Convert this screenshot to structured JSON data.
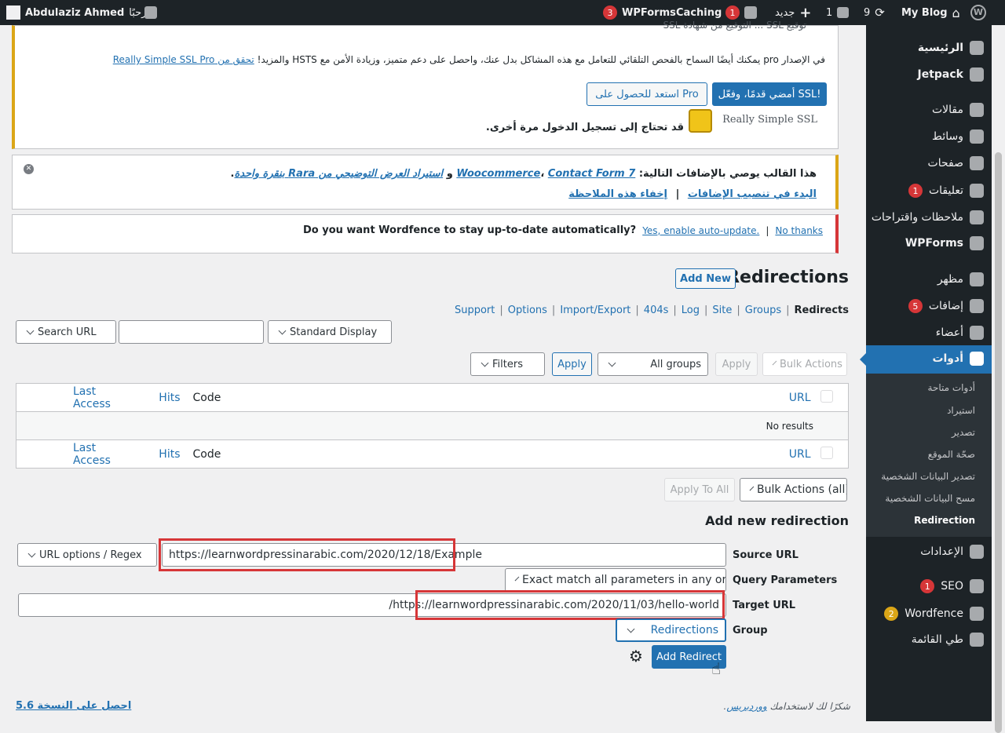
{
  "adminbar": {
    "wp_logo": "wordpress-logo",
    "site_name": "My Blog",
    "updates_count": "9",
    "comments_count": "1",
    "new_label": "جديد",
    "yoast_count": "1",
    "caching_label": "Caching",
    "wpforms_label": "WPForms",
    "wpforms_count": "3",
    "greeting": "مرحبًا،",
    "user_name": "Abdulaziz Ahmed"
  },
  "sidebar": {
    "items": [
      {
        "label": "الرئيسية",
        "icon": "dashboard-icon"
      },
      {
        "label": "Jetpack",
        "icon": "jetpack-icon"
      },
      {
        "label": "مقالات",
        "icon": "pin-icon"
      },
      {
        "label": "وسائط",
        "icon": "media-icon"
      },
      {
        "label": "صفحات",
        "icon": "pages-icon"
      },
      {
        "label": "تعليقات",
        "icon": "comments-icon",
        "badge": "1"
      },
      {
        "label": "ملاحظات واقتراحات",
        "icon": "feedback-icon"
      },
      {
        "label": "WPForms",
        "icon": "wpforms-icon"
      },
      {
        "label": "مظهر",
        "icon": "appearance-icon"
      },
      {
        "label": "إضافات",
        "icon": "plugins-icon",
        "badge": "5"
      },
      {
        "label": "أعضاء",
        "icon": "users-icon"
      },
      {
        "label": "أدوات",
        "icon": "tools-icon"
      },
      {
        "label": "الإعدادات",
        "icon": "settings-icon"
      },
      {
        "label": "SEO",
        "icon": "yoast-icon",
        "badge": "1"
      },
      {
        "label": "Wordfence",
        "icon": "wordfence-icon",
        "badge": "2"
      },
      {
        "label": "طي القائمة",
        "icon": "collapse-icon"
      }
    ],
    "submenu": [
      "أدوات متاحة",
      "استيراد",
      "تصدير",
      "صحّة الموقع",
      "تصدير البيانات الشخصية",
      "مسح البيانات الشخصية",
      "Redirection"
    ]
  },
  "ssl_notice": {
    "top_text": "توقيع SSL ... التوقيع من شهادة SSL",
    "pro_text": "في الإصدار pro يمكنك أيضًا السماح بالفحص التلقائي للتعامل مع هذه المشاكل بدل عنك، واحصل على دعم متميز، وزيادة الأمن مع HSTS والمزيد!",
    "pro_link": "تحقق من Really Simple SSL Pro",
    "activate_btn": "أمضي قدمًا، وفعّل SSL!",
    "pro_btn": "استعد للحصول على Pro",
    "relogin": "قد تحتاج إلى تسجيل الدخول مرة أخرى.",
    "logo_text": "Really Simple SSL"
  },
  "theme_notice": {
    "text": "هذا القالب يوصي بالإضافات التالية:",
    "plugin1": "Woocommerce",
    "plugin2": "Contact Form 7",
    "and": "و",
    "import_link": "استيراد العرض التوضيحي من Rara بنقرة واحدة",
    "install_link": "البدء في تنصيب الإضافات",
    "dismiss_link": "إخفاء هذه الملاحظة",
    "sep": "|"
  },
  "wordfence_notice": {
    "question": "Do you want Wordfence to stay up-to-date automatically?",
    "enable": "Yes, enable auto-update.",
    "sep": "|",
    "no": "No thanks"
  },
  "page": {
    "title": "Redirections",
    "add_new": "Add New",
    "subnav": [
      "Redirects",
      "Groups",
      "Site",
      "Log",
      "404s",
      "Import/Export",
      "Options",
      "Support"
    ],
    "subnav_sep": "|"
  },
  "search": {
    "search_select": "Search URL",
    "display_select": "Standard Display"
  },
  "filters": {
    "bulk_actions": "Bulk Actions",
    "apply": "Apply",
    "all_groups": "All groups",
    "apply2": "Apply",
    "filters": "Filters"
  },
  "table": {
    "columns": [
      "URL",
      "Code",
      "Hits",
      "Last Access"
    ],
    "empty": "No results"
  },
  "bulk_bottom": {
    "bulk_all": "Bulk Actions (all)",
    "apply_to_all": "Apply To All"
  },
  "add_form": {
    "heading": "Add new redirection",
    "source_label": "Source URL",
    "source_value": "https://learnwordpressinarabic.com/2020/12/18/Example",
    "url_options": "URL options / Regex",
    "query_label": "Query Parameters",
    "query_value": "Exact match all parameters in any order",
    "target_label": "Target URL",
    "target_value": "https://learnwordpressinarabic.com/2020/11/03/hello-world/",
    "group_label": "Group",
    "group_value": "Redirections",
    "submit": "Add Redirect"
  },
  "footer": {
    "thanks": "شكرًا لك لاستخدامك",
    "wordpress": "ووردبريس",
    "version": "احصل على النسخة 5.6"
  }
}
